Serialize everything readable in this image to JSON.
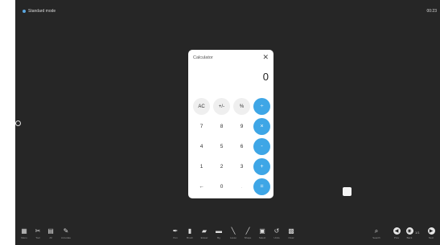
{
  "status_bar": {
    "mode_label": "Standard mode",
    "time": "00:23"
  },
  "calculator": {
    "title": "Calculator",
    "close": "✕",
    "display": "0",
    "keys": [
      {
        "label": "AC",
        "kind": "fn"
      },
      {
        "label": "+/-",
        "kind": "fn"
      },
      {
        "label": "%",
        "kind": "fn"
      },
      {
        "label": "÷",
        "kind": "op"
      },
      {
        "label": "7",
        "kind": "num"
      },
      {
        "label": "8",
        "kind": "num"
      },
      {
        "label": "9",
        "kind": "num"
      },
      {
        "label": "×",
        "kind": "op"
      },
      {
        "label": "4",
        "kind": "num"
      },
      {
        "label": "5",
        "kind": "num"
      },
      {
        "label": "6",
        "kind": "num"
      },
      {
        "label": "-",
        "kind": "op"
      },
      {
        "label": "1",
        "kind": "num"
      },
      {
        "label": "2",
        "kind": "num"
      },
      {
        "label": "3",
        "kind": "num"
      },
      {
        "label": "+",
        "kind": "op"
      },
      {
        "label": "←",
        "kind": "num"
      },
      {
        "label": "0",
        "kind": "num"
      },
      {
        "label": ".",
        "kind": "blank"
      },
      {
        "label": "=",
        "kind": "op"
      }
    ]
  },
  "toolbar": {
    "left": [
      {
        "label": "Menu",
        "icon": "menu-icon"
      },
      {
        "label": "Tool",
        "icon": "tools-icon"
      },
      {
        "label": "All",
        "icon": "grid-icon"
      },
      {
        "label": "Annotate",
        "icon": "annotate-icon"
      }
    ],
    "center": [
      {
        "label": "Pen",
        "icon": "pen-icon"
      },
      {
        "label": "Brush",
        "icon": "brush-icon"
      },
      {
        "label": "Eraser",
        "icon": "eraser-icon"
      },
      {
        "label": "Bg",
        "icon": "background-icon"
      },
      {
        "label": "Lasso",
        "icon": "lasso-icon"
      },
      {
        "label": "Shape",
        "icon": "shape-icon"
      },
      {
        "label": "Select",
        "icon": "select-icon"
      },
      {
        "label": "Undo",
        "icon": "undo-icon"
      },
      {
        "label": "Clear",
        "icon": "clear-icon"
      }
    ],
    "right": [
      {
        "label": "Search",
        "icon": "search-icon"
      },
      {
        "label": "Prev",
        "icon": "prev-icon"
      },
      {
        "label": "Back",
        "icon": "back-icon"
      },
      {
        "label": "Next",
        "icon": "next-icon"
      }
    ],
    "page_indicator": "1/1"
  }
}
